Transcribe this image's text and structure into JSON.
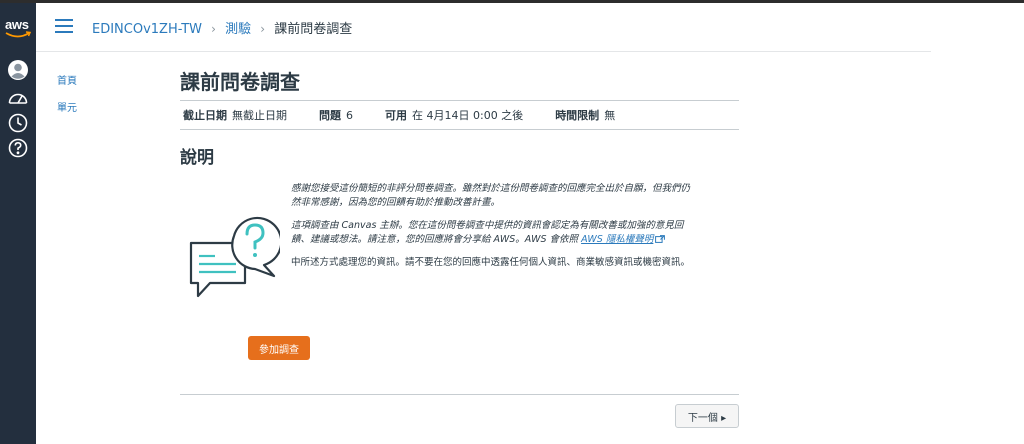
{
  "app": {
    "logo_text": "aws"
  },
  "breadcrumb": {
    "course": "EDINCOv1ZH-TW",
    "section": "測驗",
    "current": "課前問卷調查",
    "separator": "›"
  },
  "left_nav": {
    "items": [
      {
        "label": "首頁"
      },
      {
        "label": "單元"
      }
    ]
  },
  "rail": {
    "icons": [
      "account-icon",
      "dashboard-icon",
      "history-icon",
      "help-icon"
    ]
  },
  "quiz": {
    "title": "課前問卷調查",
    "meta": {
      "due_label": "截止日期",
      "due_value": "無截止日期",
      "questions_label": "問題",
      "questions_value": "6",
      "available_label": "可用",
      "available_value": "在 4月14日 0:00 之後",
      "time_limit_label": "時間限制",
      "time_limit_value": "無"
    },
    "description_title": "說明",
    "paragraph1": "感謝您接受這份簡短的非評分問卷調查。雖然對於這份問卷調查的回應完全出於自願，但我們仍然非常感謝，因為您的回饋有助於推動改善計畫。",
    "paragraph2_text": "這項調查由 Canvas 主辦。您在這份問卷調查中提供的資訊會認定為有關改善或加強的意見回饋、建議或想法。請注意，您的回應將會分享給 AWS。AWS 會依照 ",
    "paragraph2_link": "AWS 隱私權聲明",
    "paragraph3": "中所述方式處理您的資訊。請不要在您的回應中透露任何個人資訊、商業敏感資訊或機密資訊。",
    "take_button": "參加調查",
    "next_button": "下一個 ▸"
  },
  "colors": {
    "rail_bg": "#232f3e",
    "link": "#2b7abc",
    "accent_orange": "#e66f1c",
    "illustration_teal": "#3fc1c0"
  }
}
